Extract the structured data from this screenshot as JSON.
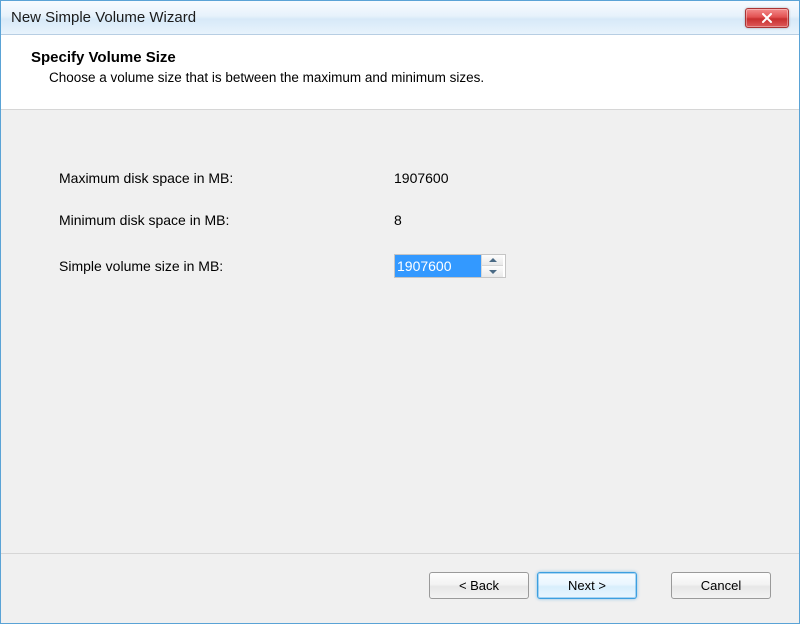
{
  "window": {
    "title": "New Simple Volume Wizard"
  },
  "header": {
    "title": "Specify Volume Size",
    "subtitle": "Choose a volume size that is between the maximum and minimum sizes."
  },
  "fields": {
    "max_space": {
      "label": "Maximum disk space in MB:",
      "value": "1907600"
    },
    "min_space": {
      "label": "Minimum disk space in MB:",
      "value": "8"
    },
    "volume_size": {
      "label": "Simple volume size in MB:",
      "value": "1907600"
    }
  },
  "buttons": {
    "back": "< Back",
    "next": "Next >",
    "cancel": "Cancel"
  }
}
